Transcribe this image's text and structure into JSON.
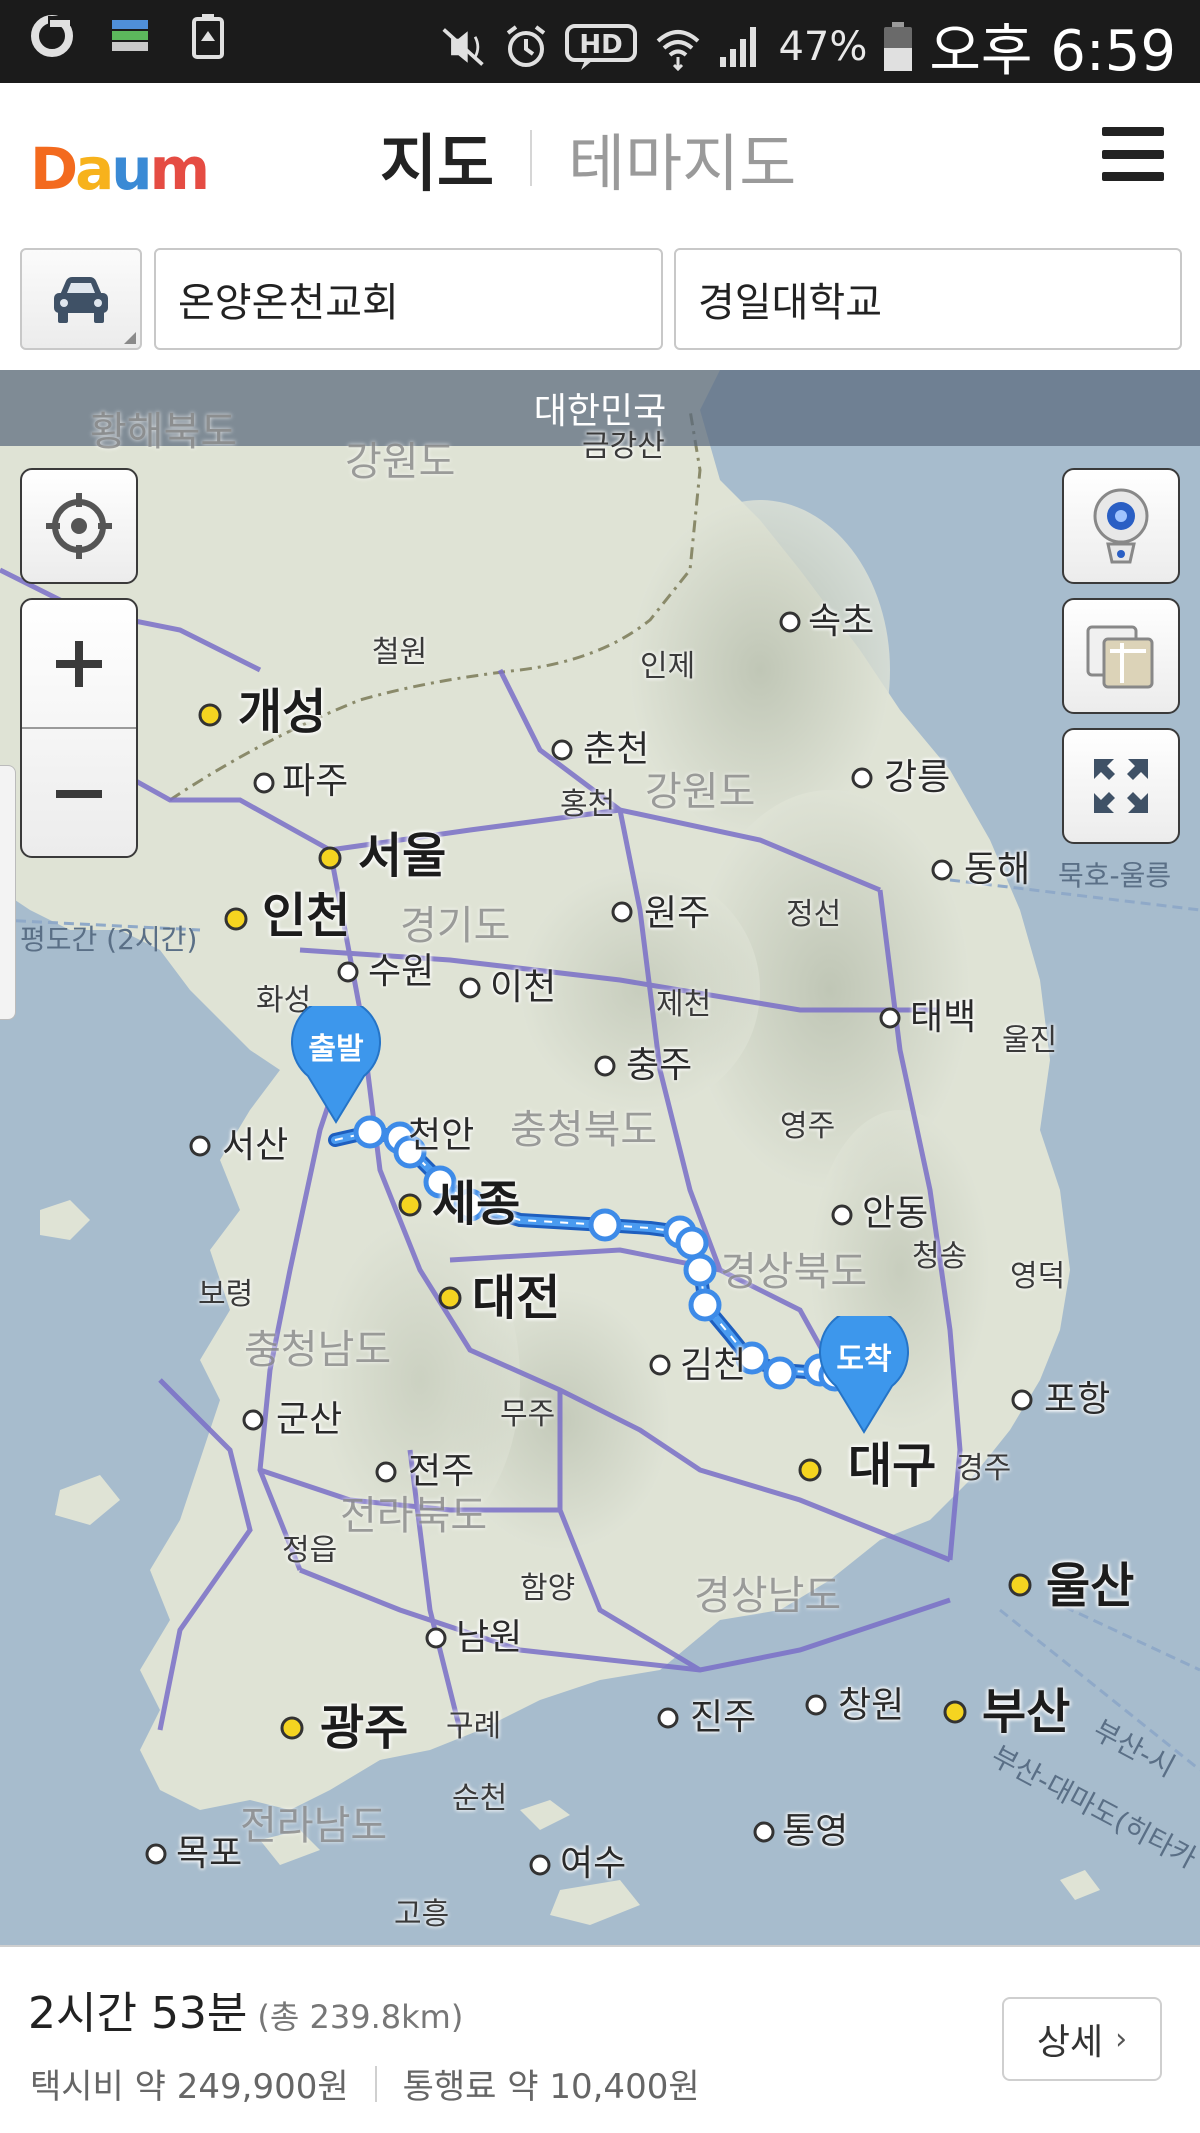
{
  "status_bar": {
    "battery": "47%",
    "time": "오후 6:59",
    "hd_label": "HD"
  },
  "header": {
    "logo": "Daum",
    "tab_map": "지도",
    "tab_theme_map": "테마지도"
  },
  "route_search": {
    "mode_icon": "car-icon",
    "origin": "온양온천교회",
    "destination": "경일대학교"
  },
  "map": {
    "region_banner": "대한민국",
    "start_marker": "출발",
    "end_marker": "도착",
    "labels": {
      "gaeseong": "개성",
      "seoul": "서울",
      "incheon": "인천",
      "daejeon": "대전",
      "gwangju": "광주",
      "busan": "부산",
      "ulsan": "울산",
      "daegu": "대구",
      "sejong": "세종",
      "paju": "파주",
      "chuncheon": "춘천",
      "sokcho": "속초",
      "gangneung": "강릉",
      "donghae": "동해",
      "wonju": "원주",
      "suwon": "수원",
      "icheon": "이천",
      "chungju": "충주",
      "cheonan": "천안",
      "seosan": "서산",
      "andong": "안동",
      "taebaek": "태백",
      "pohang": "포항",
      "gunsan": "군산",
      "jeonju": "전주",
      "namwon": "남원",
      "jinju": "진주",
      "changwon": "창원",
      "tongyeong": "통영",
      "yeosu": "여수",
      "mokpo": "목포",
      "gimcheon": "김천",
      "hwanghae": "황해북도",
      "gangwon_north": "강원도",
      "geumgang": "금강산",
      "cheorwon": "철원",
      "inje": "인제",
      "hongcheon": "홍천",
      "gangwon": "강원도",
      "jeongseon": "정선",
      "gyeonggi": "경기도",
      "hwaseong": "화성",
      "jecheon": "제천",
      "uljin": "울진",
      "chungbuk": "충청북도",
      "yeongju": "영주",
      "gyeongbuk": "경상북도",
      "cheongsong": "청송",
      "yeongdeok": "영덕",
      "boryeong": "보령",
      "chungnam": "충청남도",
      "muju": "무주",
      "gyeongju": "경주",
      "jeonbuk": "전라북도",
      "jeongeup": "정읍",
      "hamyang": "함양",
      "gyeongnam": "경상남도",
      "gurye": "구례",
      "suncheon": "순천",
      "jeonnam": "전라남도",
      "goheung": "고흥",
      "pyeongdo": "평도간 (2시간)",
      "mukho_ulleung": "묵호-울릉",
      "busan_daemado": "부산-대마도(히타카",
      "busan_short": "부산-시"
    }
  },
  "summary": {
    "duration": "2시간 53분",
    "distance": "(총 239.8km)",
    "taxi_fare": "택시비 약 249,900원",
    "toll_fee": "통행료 약 10,400원",
    "detail_button": "상세"
  },
  "colors": {
    "route": "#3d8be8",
    "marker": "#3d97ec",
    "logo_d": "#f36a1e",
    "logo_a": "#f7b21c",
    "logo_u": "#3a8ad5",
    "logo_m": "#e54c43"
  }
}
